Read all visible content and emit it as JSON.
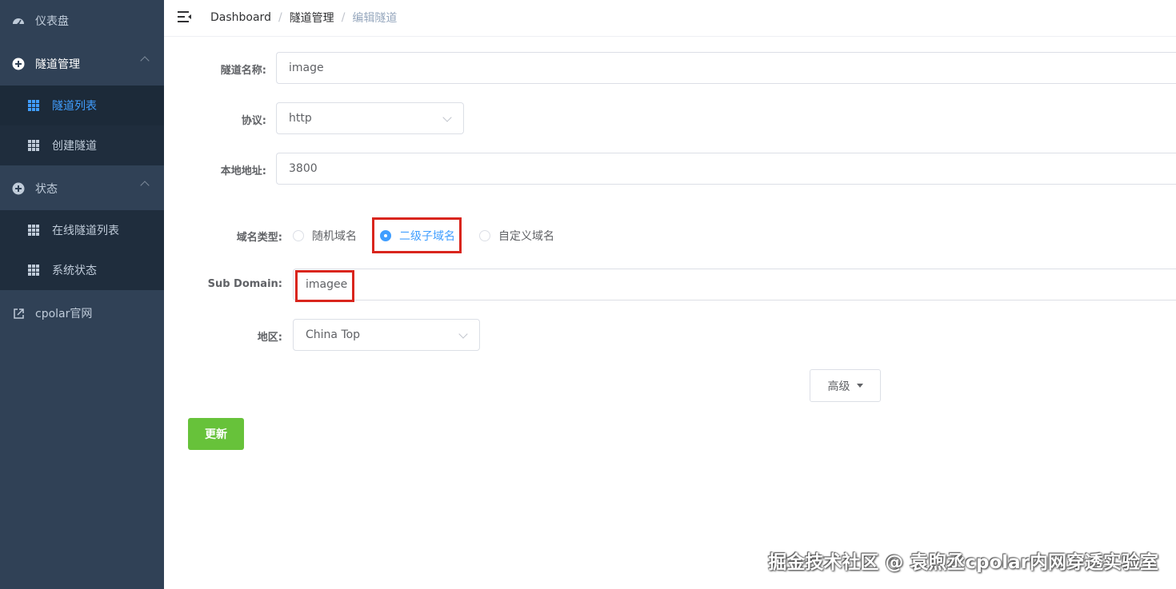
{
  "sidebar": {
    "items": [
      {
        "label": "仪表盘",
        "icon": "dashboard-icon"
      },
      {
        "label": "隧道管理",
        "icon": "circle-plus-icon"
      },
      {
        "label": "状态",
        "icon": "circle-plus-icon"
      },
      {
        "label": "cpolar官网",
        "icon": "external-link-icon"
      }
    ],
    "tunnel_sub": [
      {
        "label": "隧道列表",
        "active": true
      },
      {
        "label": "创建隧道",
        "active": false
      }
    ],
    "status_sub": [
      {
        "label": "在线隧道列表"
      },
      {
        "label": "系统状态"
      }
    ]
  },
  "breadcrumb": {
    "home": "Dashboard",
    "section": "隧道管理",
    "current": "编辑隧道"
  },
  "form": {
    "name_label": "隧道名称:",
    "name_value": "image",
    "protocol_label": "协议:",
    "protocol_value": "http",
    "local_label": "本地地址:",
    "local_value": "3800",
    "domain_type_label": "域名类型:",
    "domain_types": [
      "随机域名",
      "二级子域名",
      "自定义域名"
    ],
    "domain_type_selected": "二级子域名",
    "subdomain_label": "Sub Domain:",
    "subdomain_value": "imagee",
    "region_label": "地区:",
    "region_value": "China Top",
    "advanced_label": "高级",
    "update_label": "更新"
  },
  "watermark": "掘金技术社区 @ 袁煦丞cpolar内网穿透实验室",
  "colors": {
    "sidebar_bg": "#304156",
    "submenu_bg": "#1f2d3d",
    "active": "#409eff",
    "update_button": "#67c23a",
    "highlight_box": "#d9251d"
  }
}
